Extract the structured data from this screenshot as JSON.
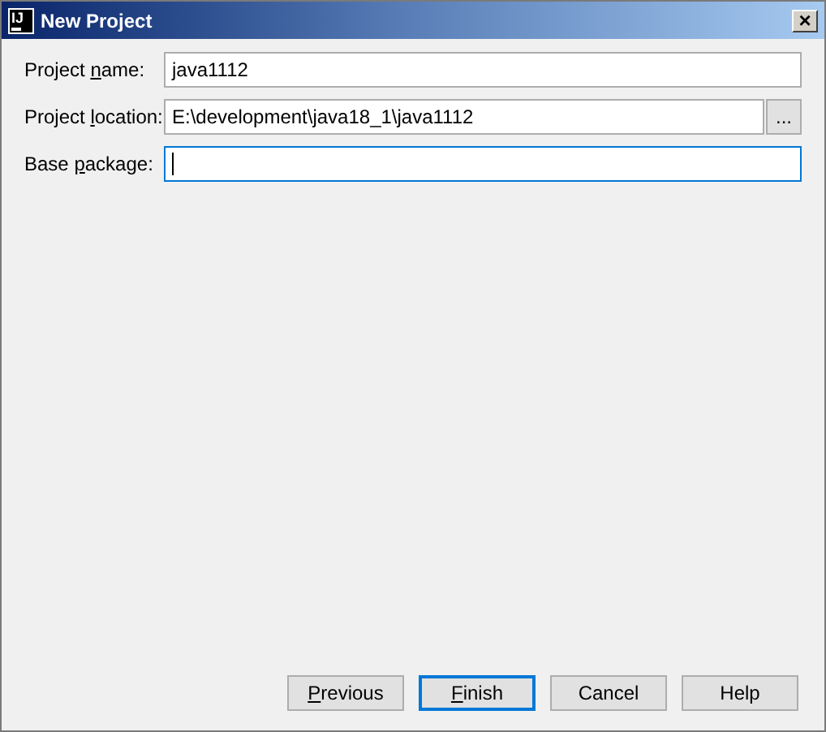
{
  "window": {
    "logo": "IJ",
    "title": "New Project",
    "close": "×"
  },
  "fields": [
    {
      "label": {
        "pre": "Project ",
        "key": "n",
        "post": "ame:"
      },
      "value": "java1112",
      "focused": false
    },
    {
      "label": {
        "pre": "Project ",
        "key": "l",
        "post": "ocation:"
      },
      "value": "E:\\development\\java18_1\\java1112",
      "focused": false,
      "browse": "..."
    },
    {
      "label": {
        "pre": "Base ",
        "key": "p",
        "post": "ackage:"
      },
      "focused": true
    }
  ],
  "buttons": [
    {
      "label": {
        "key": "P",
        "post": "revious"
      },
      "default": false
    },
    {
      "label": {
        "key": "F",
        "post": "inish"
      },
      "default": true
    },
    {
      "label": {
        "pre": "Cancel"
      },
      "default": false
    },
    {
      "label": {
        "pre": "Help"
      },
      "default": false
    }
  ]
}
